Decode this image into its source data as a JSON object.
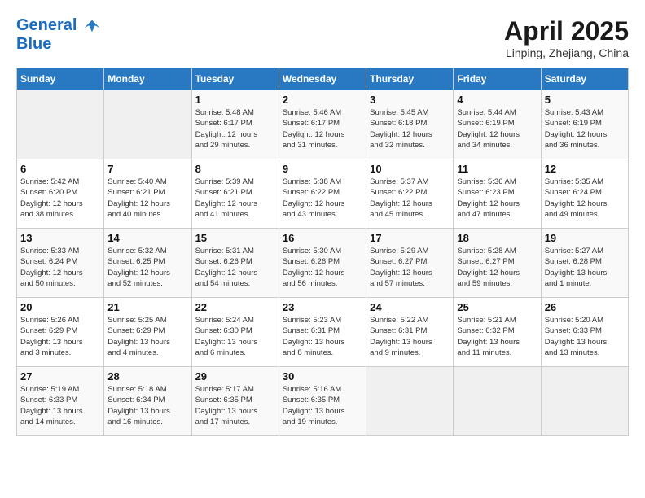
{
  "header": {
    "logo_line1": "General",
    "logo_line2": "Blue",
    "month_year": "April 2025",
    "location": "Linping, Zhejiang, China"
  },
  "days_of_week": [
    "Sunday",
    "Monday",
    "Tuesday",
    "Wednesday",
    "Thursday",
    "Friday",
    "Saturday"
  ],
  "weeks": [
    [
      {
        "day": "",
        "info": ""
      },
      {
        "day": "",
        "info": ""
      },
      {
        "day": "1",
        "info": "Sunrise: 5:48 AM\nSunset: 6:17 PM\nDaylight: 12 hours\nand 29 minutes."
      },
      {
        "day": "2",
        "info": "Sunrise: 5:46 AM\nSunset: 6:17 PM\nDaylight: 12 hours\nand 31 minutes."
      },
      {
        "day": "3",
        "info": "Sunrise: 5:45 AM\nSunset: 6:18 PM\nDaylight: 12 hours\nand 32 minutes."
      },
      {
        "day": "4",
        "info": "Sunrise: 5:44 AM\nSunset: 6:19 PM\nDaylight: 12 hours\nand 34 minutes."
      },
      {
        "day": "5",
        "info": "Sunrise: 5:43 AM\nSunset: 6:19 PM\nDaylight: 12 hours\nand 36 minutes."
      }
    ],
    [
      {
        "day": "6",
        "info": "Sunrise: 5:42 AM\nSunset: 6:20 PM\nDaylight: 12 hours\nand 38 minutes."
      },
      {
        "day": "7",
        "info": "Sunrise: 5:40 AM\nSunset: 6:21 PM\nDaylight: 12 hours\nand 40 minutes."
      },
      {
        "day": "8",
        "info": "Sunrise: 5:39 AM\nSunset: 6:21 PM\nDaylight: 12 hours\nand 41 minutes."
      },
      {
        "day": "9",
        "info": "Sunrise: 5:38 AM\nSunset: 6:22 PM\nDaylight: 12 hours\nand 43 minutes."
      },
      {
        "day": "10",
        "info": "Sunrise: 5:37 AM\nSunset: 6:22 PM\nDaylight: 12 hours\nand 45 minutes."
      },
      {
        "day": "11",
        "info": "Sunrise: 5:36 AM\nSunset: 6:23 PM\nDaylight: 12 hours\nand 47 minutes."
      },
      {
        "day": "12",
        "info": "Sunrise: 5:35 AM\nSunset: 6:24 PM\nDaylight: 12 hours\nand 49 minutes."
      }
    ],
    [
      {
        "day": "13",
        "info": "Sunrise: 5:33 AM\nSunset: 6:24 PM\nDaylight: 12 hours\nand 50 minutes."
      },
      {
        "day": "14",
        "info": "Sunrise: 5:32 AM\nSunset: 6:25 PM\nDaylight: 12 hours\nand 52 minutes."
      },
      {
        "day": "15",
        "info": "Sunrise: 5:31 AM\nSunset: 6:26 PM\nDaylight: 12 hours\nand 54 minutes."
      },
      {
        "day": "16",
        "info": "Sunrise: 5:30 AM\nSunset: 6:26 PM\nDaylight: 12 hours\nand 56 minutes."
      },
      {
        "day": "17",
        "info": "Sunrise: 5:29 AM\nSunset: 6:27 PM\nDaylight: 12 hours\nand 57 minutes."
      },
      {
        "day": "18",
        "info": "Sunrise: 5:28 AM\nSunset: 6:27 PM\nDaylight: 12 hours\nand 59 minutes."
      },
      {
        "day": "19",
        "info": "Sunrise: 5:27 AM\nSunset: 6:28 PM\nDaylight: 13 hours\nand 1 minute."
      }
    ],
    [
      {
        "day": "20",
        "info": "Sunrise: 5:26 AM\nSunset: 6:29 PM\nDaylight: 13 hours\nand 3 minutes."
      },
      {
        "day": "21",
        "info": "Sunrise: 5:25 AM\nSunset: 6:29 PM\nDaylight: 13 hours\nand 4 minutes."
      },
      {
        "day": "22",
        "info": "Sunrise: 5:24 AM\nSunset: 6:30 PM\nDaylight: 13 hours\nand 6 minutes."
      },
      {
        "day": "23",
        "info": "Sunrise: 5:23 AM\nSunset: 6:31 PM\nDaylight: 13 hours\nand 8 minutes."
      },
      {
        "day": "24",
        "info": "Sunrise: 5:22 AM\nSunset: 6:31 PM\nDaylight: 13 hours\nand 9 minutes."
      },
      {
        "day": "25",
        "info": "Sunrise: 5:21 AM\nSunset: 6:32 PM\nDaylight: 13 hours\nand 11 minutes."
      },
      {
        "day": "26",
        "info": "Sunrise: 5:20 AM\nSunset: 6:33 PM\nDaylight: 13 hours\nand 13 minutes."
      }
    ],
    [
      {
        "day": "27",
        "info": "Sunrise: 5:19 AM\nSunset: 6:33 PM\nDaylight: 13 hours\nand 14 minutes."
      },
      {
        "day": "28",
        "info": "Sunrise: 5:18 AM\nSunset: 6:34 PM\nDaylight: 13 hours\nand 16 minutes."
      },
      {
        "day": "29",
        "info": "Sunrise: 5:17 AM\nSunset: 6:35 PM\nDaylight: 13 hours\nand 17 minutes."
      },
      {
        "day": "30",
        "info": "Sunrise: 5:16 AM\nSunset: 6:35 PM\nDaylight: 13 hours\nand 19 minutes."
      },
      {
        "day": "",
        "info": ""
      },
      {
        "day": "",
        "info": ""
      },
      {
        "day": "",
        "info": ""
      }
    ]
  ]
}
